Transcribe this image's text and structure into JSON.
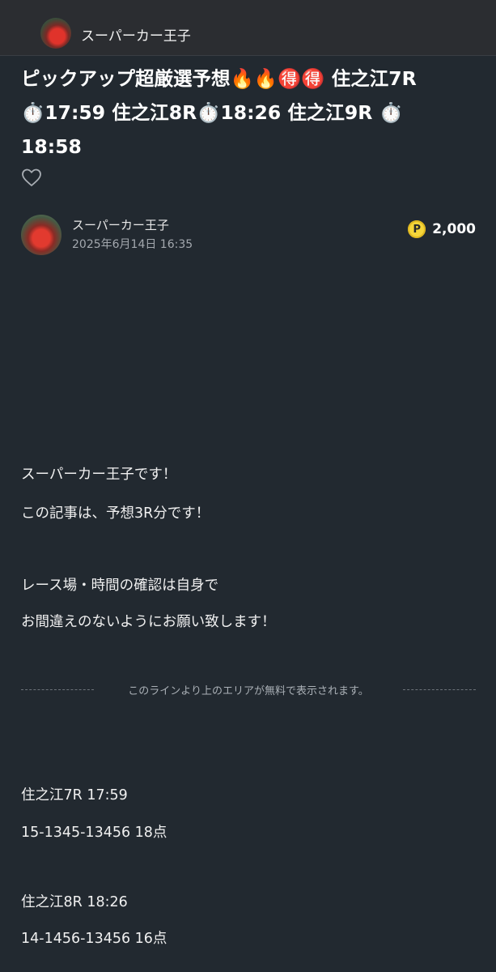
{
  "header": {
    "author_name": "スーパーカー王子"
  },
  "article": {
    "title": "ピックアップ超厳選予想🔥🔥🉐🉐 住之江7R\n⏱️17:59 住之江8R⏱️18:26 住之江9R ⏱️\n18:58",
    "author_name": "スーパーカー王子",
    "date": "2025年6月14日 16:35",
    "price": "2,000",
    "price_icon": "P",
    "like_icon": "heart-icon"
  },
  "body": {
    "lines": [
      "スーパーカー王子です！",
      "この記事は、予想3R分です！",
      "レース場・時間の確認は自身で",
      "お間違えのないようにお願い致します！"
    ]
  },
  "paywall": {
    "label": "このラインより上のエリアが無料で表示されます。"
  },
  "predictions": [
    {
      "race": "住之江7R 17:59",
      "bet": "15-1345-13456 18点"
    },
    {
      "race": "住之江8R 18:26",
      "bet": "14-1456-13456 16点"
    }
  ],
  "colors": {
    "background": "#222930",
    "topbar": "#2b2d31",
    "coin": "#f5d63a"
  }
}
